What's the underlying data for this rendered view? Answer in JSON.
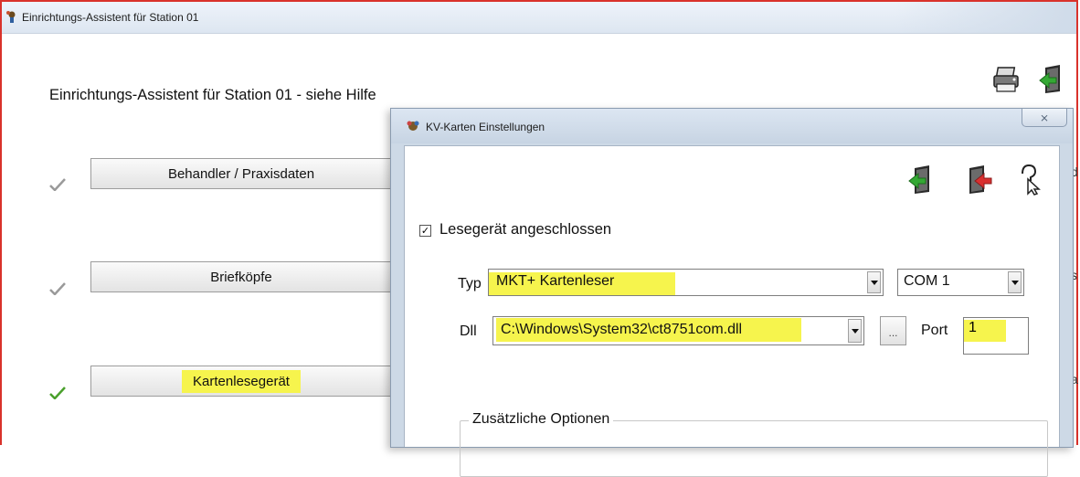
{
  "window": {
    "title": "Einrichtungs-Assistent für Station 01",
    "heading": "Einrichtungs-Assistent für Station  01 - siehe Hilfe"
  },
  "assistant_buttons": [
    {
      "label": "Behandler / Praxisdaten",
      "done": true
    },
    {
      "label": "Briefköpfe",
      "done": true
    },
    {
      "label": "Kartenlesegerät",
      "done": true,
      "highlighted": true
    }
  ],
  "toolbar_icons": [
    "printer-icon",
    "exit-door-icon"
  ],
  "right_clipped": [
    "d",
    "s",
    "a"
  ],
  "dialog": {
    "title": "KV-Karten Einstellungen",
    "close_symbol": "⨯",
    "icons": [
      "exit-door-green-icon",
      "exit-door-red-icon",
      "help-pointer-icon"
    ],
    "reader_connected": {
      "label": "Lesegerät angeschlossen",
      "checked": true
    },
    "typ": {
      "label": "Typ",
      "value": "MKT+ Kartenleser"
    },
    "com": {
      "value": "COM 1"
    },
    "dll": {
      "label": "Dll",
      "value": "C:\\Windows\\System32\\ct8751com.dll"
    },
    "browse": {
      "label": "..."
    },
    "port": {
      "label": "Port",
      "value": "1"
    },
    "options_group": {
      "label": "Zusätzliche Optionen"
    }
  },
  "colors": {
    "window_border": "#d9322b",
    "highlight": "#f6f44d",
    "dialog_frame": "#cdd9e6",
    "check_done": "#9a9a9a",
    "check_active": "#4aa02c"
  }
}
